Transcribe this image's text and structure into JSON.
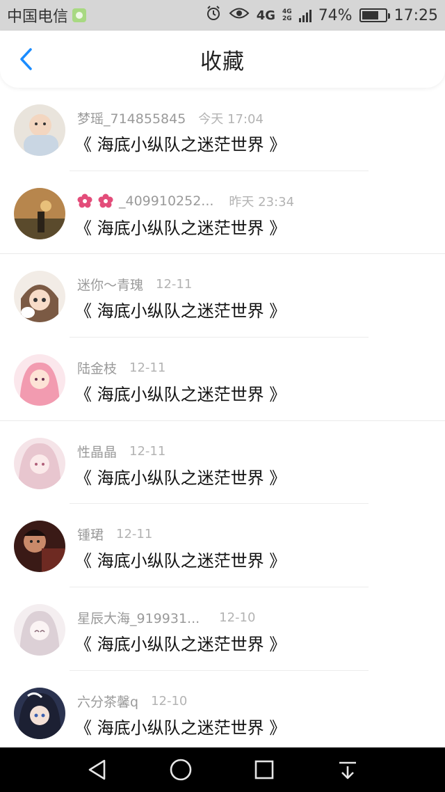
{
  "status_bar": {
    "carrier": "中国电信",
    "network_top": "4G",
    "network_bottom": "2G",
    "network_main": "4G",
    "battery_percent": "74%",
    "battery_level": 0.74,
    "time": "17:25"
  },
  "header": {
    "title": "收藏"
  },
  "favorites": [
    {
      "username": "梦瑶_714855845",
      "time": "今天 17:04",
      "title": "《 海底小纵队之迷茫世界 》"
    },
    {
      "username": "_409910252...",
      "time": "昨天 23:34",
      "title": "《 海底小纵队之迷茫世界 》"
    },
    {
      "username": "迷你～青瑰",
      "time": "12-11",
      "title": "《 海底小纵队之迷茫世界 》"
    },
    {
      "username": "陆金枝",
      "time": "12-11",
      "title": "《 海底小纵队之迷茫世界 》"
    },
    {
      "username": "性晶晶",
      "time": "12-11",
      "title": "《 海底小纵队之迷茫世界 》"
    },
    {
      "username": "锺珺",
      "time": "12-11",
      "title": "《 海底小纵队之迷茫世界 》"
    },
    {
      "username": "星辰大海_919931...",
      "time": "12-10",
      "title": "《 海底小纵队之迷茫世界 》"
    },
    {
      "username": "六分茶馨q",
      "time": "12-10",
      "title": "《 海底小纵队之迷茫世界 》"
    }
  ],
  "icons": {
    "back": "chevron-left-icon",
    "nav_back": "triangle-back-icon",
    "nav_home": "circle-home-icon",
    "nav_recent": "square-recent-icon",
    "nav_down": "arrow-down-icon"
  },
  "colors": {
    "accent_blue": "#1a8cff",
    "status_bar_bg": "#d6d6d6",
    "nav_bar_bg": "#000000"
  }
}
